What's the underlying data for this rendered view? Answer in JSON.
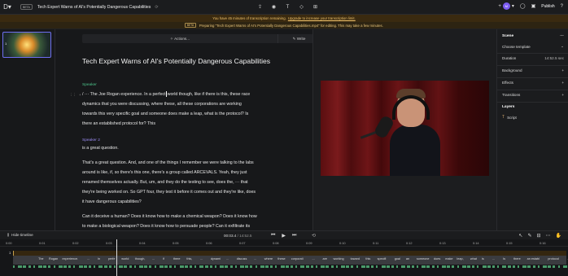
{
  "topbar": {
    "logo": "D",
    "beta": "BETA",
    "doc_title": "Tech Expert Warns of AI's Potentially Dangerous Capabilities",
    "avatar": "M",
    "publish": "Publish"
  },
  "banners": {
    "minutes": "You have 45 minutes of transcription remaining.",
    "upgrade": "Upgrade to increase your transcription limit.",
    "beta": "BETA",
    "preparing": "Preparing \"Tech Expert Warns of AI's Potentially Dangerous Capabilities.mp4\" for editing. This may take a few minutes."
  },
  "scene_number": "1",
  "actionbar": {
    "actions": "Actions...",
    "write": "Write"
  },
  "script": {
    "title": "Tech Expert Warns of AI's Potentially Dangerous Capabilities",
    "speaker1": "Speaker",
    "p1": [
      "/ ··· The Joe Rogan experience. In a perfect",
      "world though, like if there is this, these race",
      "dynamics that you were discussing, where these, all these corporations are working",
      "towards this very specific goal and someone does make a leap, what is the protocol? Is",
      "there an established protocol for? This"
    ],
    "p2": "is a great question.",
    "speaker2": "Speaker 2",
    "p3": [
      "That's a great question. And, and one of the things I remember we were talking to the labs",
      "around is like, if, so there's this one, there's a group called ARCEVALS. Yeah, they just",
      "renamed themselves actually. But, um, and they do the testing to see, does the, ··· that",
      "they're being worked on. So GPT four, they test it before it comes out and they're like, does",
      "it have dangerous capabilities?"
    ],
    "p4": [
      "Can it deceive a human? Does it know how to make a chemical weapon? Does it know how",
      "to make a biological weapon? Does it know how to persuade people? Can it exfiltrate its"
    ]
  },
  "props": {
    "scene": "Scene",
    "template": "Choose template",
    "duration_label": "Duration",
    "duration_value": "14:52.5 sec",
    "background": "Background",
    "effects": "Effects",
    "transitions": "Transitions",
    "layers": "Layers",
    "layer_script": "Script"
  },
  "transport": {
    "hide_timeline": "Hide timeline",
    "current": "00:03.4",
    "total": "/ 14:52.5"
  },
  "timeline": {
    "ticks": [
      "0:00",
      "0:01",
      "0:02",
      "0:03",
      "0:04",
      "0:05",
      "0:06",
      "0:07",
      "0:08",
      "0:09",
      "0:10",
      "0:11",
      "0:12",
      "0:13",
      "0:14",
      "0:15",
      "0:16"
    ],
    "lane": "1",
    "words": [
      "The",
      "Rogan",
      "experience.",
      "...",
      "In",
      "perfe",
      "world",
      "though,",
      "...",
      "if",
      "there",
      "this,",
      "...",
      "dynami",
      "...",
      "discuss",
      "...",
      "where",
      "these",
      "corporati",
      "...",
      "are",
      "working",
      "toward",
      "this",
      "specifi",
      "goal",
      "an",
      "someone",
      "does",
      "make",
      "leap,",
      "what",
      "is",
      "...",
      "Is",
      "there",
      "an establ",
      "protocol",
      "...",
      "for?",
      "Th"
    ]
  },
  "colors": {
    "speaker1": "#4cc38a",
    "speaker2": "#9d8df5",
    "accent": "#7b5cf0",
    "banner": "#f1c36b"
  }
}
